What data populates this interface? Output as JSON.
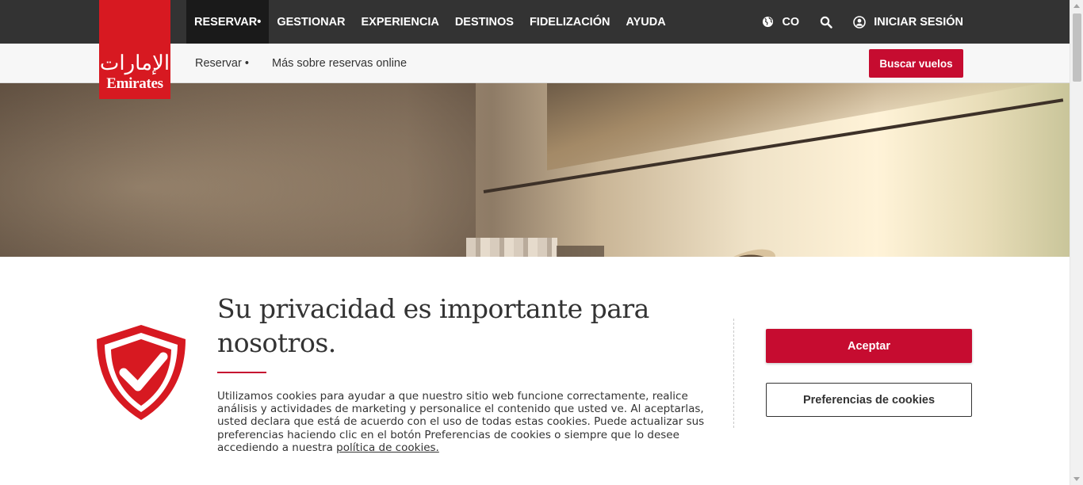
{
  "brand": {
    "logo_glyph": "ﺍﻹﻣﺎﺭﺍﺕ",
    "logo_word": "Emirates",
    "color": "#d71921"
  },
  "nav": {
    "items": [
      {
        "label": "RESERVAR"
      },
      {
        "label": "GESTIONAR"
      },
      {
        "label": "EXPERIENCIA"
      },
      {
        "label": "DESTINOS"
      },
      {
        "label": "FIDELIZACIÓN"
      },
      {
        "label": "AYUDA"
      }
    ],
    "active_marker": "•",
    "country": "CO",
    "country_icon": "globe-icon",
    "search_icon": "search-icon",
    "login_icon": "user-icon",
    "login_label": "INICIAR SESIÓN"
  },
  "subnav": {
    "items": [
      {
        "label": "Reservar •"
      },
      {
        "label": "Más sobre reservas online"
      }
    ],
    "cta_label": "Buscar vuelos"
  },
  "cookie": {
    "icon": "shield-check-icon",
    "title": "Su privacidad es importante para nosotros.",
    "body": "Utilizamos cookies para ayudar a que nuestro sitio web funcione correctamente, realice análisis y actividades de marketing y personalice el contenido que usted ve. Al aceptarlas, usted declara que está de acuerdo con el uso de todas estas cookies. Puede actualizar sus preferencias haciendo clic en el botón Preferencias de cookies o siempre que lo desee accediendo a nuestra",
    "link_label": "política de cookies.",
    "accept_label": "Aceptar",
    "prefs_label": "Preferencias de cookies"
  },
  "colors": {
    "topbar": "#333333",
    "accent": "#c60c30"
  }
}
